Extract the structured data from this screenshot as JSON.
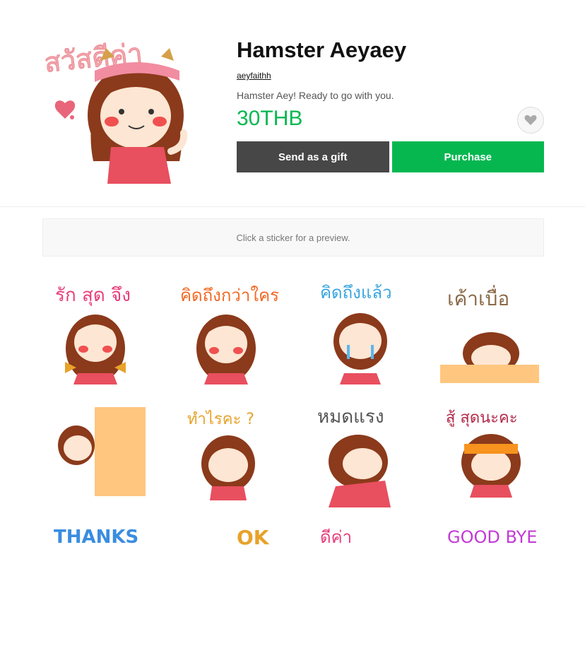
{
  "product": {
    "title": "Hamster Aeyaey",
    "author": "aeyfaithh",
    "description": "Hamster Aey! Ready to go with you.",
    "price": "30THB",
    "main_sticker_text": "สวัสดีค่า"
  },
  "actions": {
    "gift_label": "Send as a gift",
    "purchase_label": "Purchase"
  },
  "preview": {
    "hint": "Click a sticker for a preview."
  },
  "stickers": [
    {
      "text": "รัก สุด จึง"
    },
    {
      "text": "คิดถึงกว่าใคร"
    },
    {
      "text": "คิดถึงแล้ว"
    },
    {
      "text": "เค้าเบื่อ"
    },
    {
      "text": ""
    },
    {
      "text": "ทำไรคะ ?"
    },
    {
      "text": "หมดแรง"
    },
    {
      "text": "สู้ สุดนะคะ"
    },
    {
      "text": "THANKS"
    },
    {
      "text": "OK"
    },
    {
      "text": "ดีค่า"
    },
    {
      "text": "GOOD BYE"
    }
  ],
  "colors": {
    "accent": "#06b750",
    "gift": "#474747"
  }
}
